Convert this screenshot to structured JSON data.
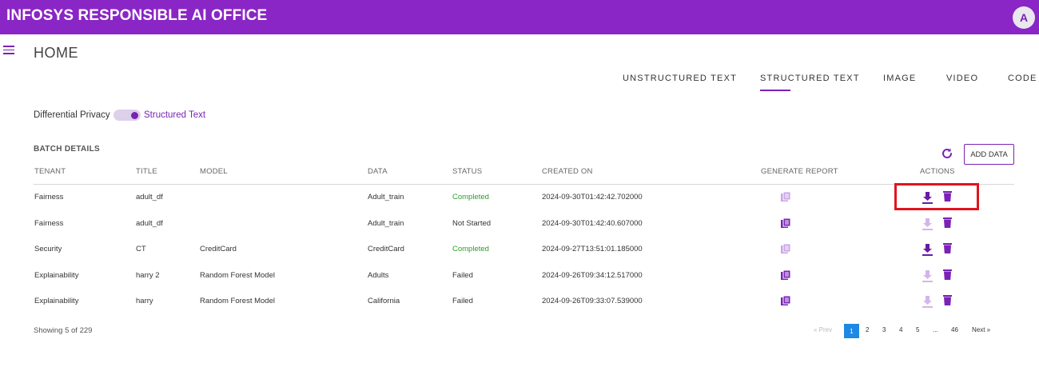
{
  "header": {
    "title": "INFOSYS RESPONSIBLE AI OFFICE",
    "avatar_initial": "A"
  },
  "page": {
    "title": "HOME"
  },
  "tabs": [
    {
      "label": "UNSTRUCTURED TEXT",
      "active": false
    },
    {
      "label": "STRUCTURED TEXT",
      "active": true
    },
    {
      "label": "IMAGE",
      "active": false
    },
    {
      "label": "VIDEO",
      "active": false
    },
    {
      "label": "CODE",
      "active": false
    }
  ],
  "options": {
    "toggle_left_label": "Differential Privacy",
    "toggle_right_label": "Structured Text",
    "toggle_on": true
  },
  "batch": {
    "section_title": "BATCH DETAILS",
    "add_button_label": "ADD DATA",
    "columns": [
      "TENANT",
      "TITLE",
      "MODEL",
      "DATA",
      "STATUS",
      "CREATED ON",
      "GENERATE REPORT",
      "ACTIONS"
    ],
    "rows": [
      {
        "tenant": "Fairness",
        "title": "adult_df",
        "model": "",
        "data": "Adult_train",
        "status": "Completed",
        "created_on": "2024-09-30T01:42:42.702000",
        "report_enabled": false,
        "download_enabled": true
      },
      {
        "tenant": "Fairness",
        "title": "adult_df",
        "model": "",
        "data": "Adult_train",
        "status": "Not Started",
        "created_on": "2024-09-30T01:42:40.607000",
        "report_enabled": true,
        "download_enabled": false
      },
      {
        "tenant": "Security",
        "title": "CT",
        "model": "CreditCard",
        "data": "CreditCard",
        "status": "Completed",
        "created_on": "2024-09-27T13:51:01.185000",
        "report_enabled": false,
        "download_enabled": true
      },
      {
        "tenant": "Explainability",
        "title": "harry 2",
        "model": "Random Forest Model",
        "data": "Adults",
        "status": "Failed",
        "created_on": "2024-09-26T09:34:12.517000",
        "report_enabled": true,
        "download_enabled": false
      },
      {
        "tenant": "Explainability",
        "title": "harry",
        "model": "Random Forest Model",
        "data": "California",
        "status": "Failed",
        "created_on": "2024-09-26T09:33:07.539000",
        "report_enabled": true,
        "download_enabled": false
      }
    ],
    "showing_text": "Showing 5 of 229"
  },
  "pagination": {
    "prev": "« Prev",
    "pages": [
      "1",
      "2",
      "3",
      "4",
      "5",
      "...",
      "46"
    ],
    "active_page": "1",
    "next": "Next »"
  },
  "icons": {
    "menu": "menu-icon",
    "refresh": "refresh-icon",
    "report": "report-icon",
    "download": "download-icon",
    "delete": "trash-icon"
  },
  "colors": {
    "brand": "#8a26c5",
    "accent": "#7a22b5",
    "completed": "#2f9b2f",
    "pager_active": "#1e88e5",
    "highlight": "#e0141e"
  }
}
